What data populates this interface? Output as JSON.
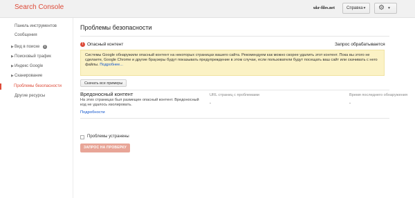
{
  "header": {
    "logo": "Search Console",
    "site": "ukr-files.net",
    "help_label": "Справка"
  },
  "sidebar": {
    "items": [
      {
        "label": "Панель инструментов",
        "expandable": false,
        "active": false
      },
      {
        "label": "Сообщения",
        "expandable": false,
        "active": false
      },
      {
        "label": "Вид в поиске",
        "expandable": true,
        "active": false
      },
      {
        "label": "Поисковый трафик",
        "expandable": true,
        "active": false
      },
      {
        "label": "Индекс Google",
        "expandable": true,
        "active": false
      },
      {
        "label": "Сканирование",
        "expandable": true,
        "active": false
      },
      {
        "label": "Проблемы безопасности",
        "expandable": false,
        "active": true
      },
      {
        "label": "Другие ресурсы",
        "expandable": false,
        "active": false
      }
    ]
  },
  "main": {
    "title": "Проблемы безопасности",
    "issue": {
      "title": "Опасный контент",
      "status": "Запрос обрабатывается",
      "warning_text": "Системы Google обнаружили опасный контент на некоторых страницах вашего сайта. Рекомендуем как можно скорее удалить этот контент. Пока вы этого не сделаете, Google Chrome и другие браузеры будут показывать предупреждение в этом случае, если пользователи будут посещать ваш сайт или скачивать с него файлы.",
      "warning_link": "Подробнее..."
    },
    "download_label": "Скачать все примеры",
    "table": {
      "headers": [
        "URL страниц с проблемами",
        "Время последнего обнаружения"
      ],
      "row": {
        "title": "Вредоносный контент",
        "description": "На этих страницах был размещен опасный контент. Вредоносный код не удалось изолировать.",
        "urls": "-",
        "last_detected": "-",
        "details_link": "Подробности"
      }
    },
    "resolved_label": "Проблемы устранены",
    "review_button": "ЗАПРОС НА ПРОВЕРКУ"
  },
  "colors": {
    "accent": "#dd4b39",
    "warning_bg": "#fbf2c5",
    "link": "#1155cc"
  }
}
